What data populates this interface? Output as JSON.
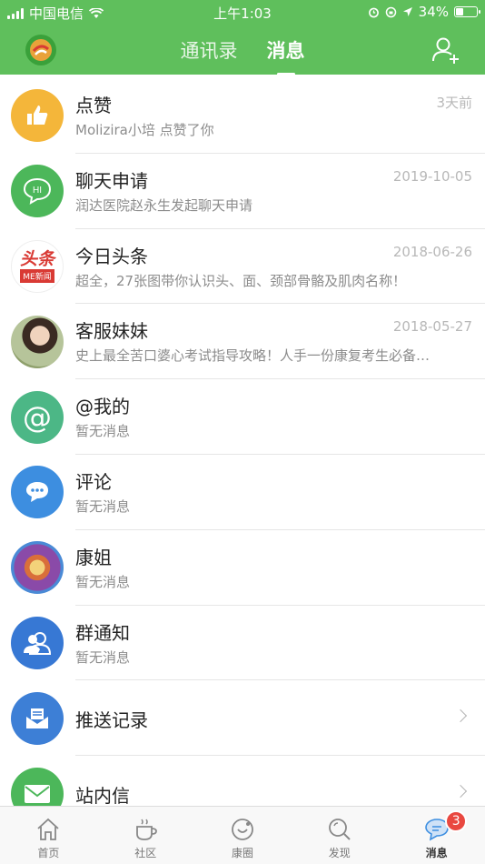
{
  "status_bar": {
    "carrier": "中国电信",
    "time": "上午1:03",
    "battery_percent": "34%",
    "battery_level": 0.34
  },
  "header": {
    "tabs": [
      {
        "label": "通讯录",
        "active": false
      },
      {
        "label": "消息",
        "active": true
      }
    ],
    "accent_color": "#5fbf5c",
    "right_icon": "add-contact-icon",
    "left_icon": "app-logo"
  },
  "messages": [
    {
      "title": "点赞",
      "subtitle": "Molizira小培 点赞了你",
      "time": "3天前",
      "icon": "thumbs-up-icon",
      "color": "#f4b63a"
    },
    {
      "title": "聊天申请",
      "subtitle": "润达医院赵永生发起聊天申请",
      "time": "2019-10-05",
      "icon": "chat-hi-icon",
      "color": "#4cb75a",
      "icon_text": "HI"
    },
    {
      "title": "今日头条",
      "subtitle": "超全，27张图带你认识头、面、颈部骨骼及肌肉名称！",
      "time": "2018-06-26",
      "icon": "toutiao-logo",
      "color": "#d93a34",
      "icon_text": "头条",
      "icon_sub": "ME新闻"
    },
    {
      "title": "客服妹妹",
      "subtitle": "史上最全苦口婆心考试指导攻略！人手一份康复考生必备…",
      "time": "2018-05-27",
      "icon": "user-photo-avatar",
      "color": "#c8b59a"
    },
    {
      "title": "@我的",
      "subtitle": "暂无消息",
      "time": "",
      "icon": "at-icon",
      "color": "#4cb786"
    },
    {
      "title": "评论",
      "subtitle": "暂无消息",
      "time": "",
      "icon": "comment-icon",
      "color": "#3d8ee0"
    },
    {
      "title": "康姐",
      "subtitle": "暂无消息",
      "time": "",
      "icon": "kangjie-avatar",
      "color": "#8a4aa8"
    },
    {
      "title": "群通知",
      "subtitle": "暂无消息",
      "time": "",
      "icon": "group-icon",
      "color": "#3778d4"
    },
    {
      "title": "推送记录",
      "subtitle": "",
      "time": "",
      "icon": "push-record-icon",
      "color": "#3d7fd6",
      "chevron": true
    },
    {
      "title": "站内信",
      "subtitle": "",
      "time": "",
      "icon": "mail-icon",
      "color": "#4cb75a",
      "chevron": true
    }
  ],
  "bottom_nav": [
    {
      "label": "首页",
      "icon": "home-icon",
      "active": false
    },
    {
      "label": "社区",
      "icon": "cup-icon",
      "active": false
    },
    {
      "label": "康圈",
      "icon": "circle-icon",
      "active": false
    },
    {
      "label": "发现",
      "icon": "search-icon",
      "active": false
    },
    {
      "label": "消息",
      "icon": "message-icon",
      "active": true,
      "badge": "3"
    }
  ]
}
